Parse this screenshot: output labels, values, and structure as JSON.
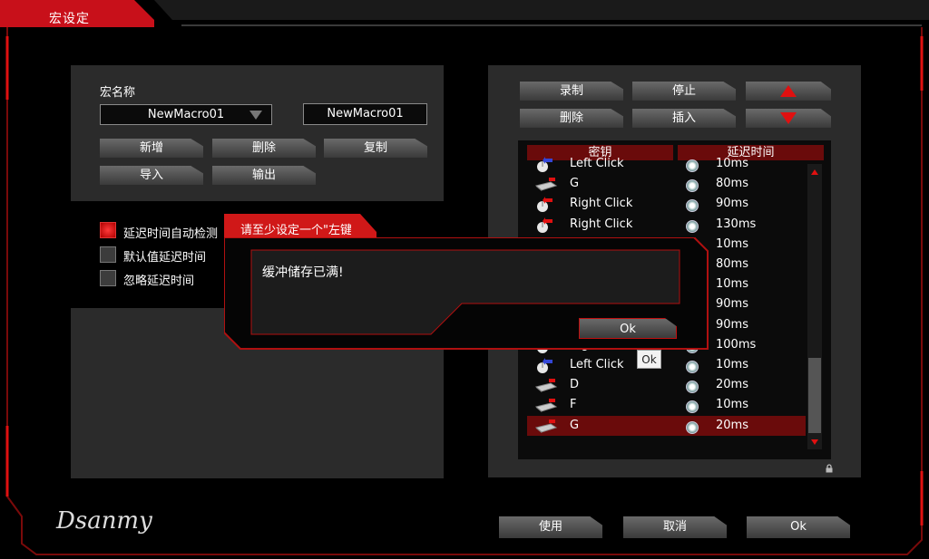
{
  "window": {
    "title": "宏设定"
  },
  "left_panel": {
    "macro_name_label": "宏名称",
    "macro_select_value": "NewMacro01",
    "macro_name_input": "NewMacro01",
    "buttons": {
      "add": "新增",
      "delete": "删除",
      "copy": "复制",
      "import": "导入",
      "export": "输出"
    }
  },
  "options": {
    "auto_detect": "延迟时间自动检测",
    "default_delay": "默认值延迟时间",
    "ignore_delay": "忽略延迟时间",
    "auto_detect_checked": true,
    "default_delay_checked": false,
    "ignore_delay_checked": false
  },
  "right_panel": {
    "buttons": {
      "record": "录制",
      "stop": "停止",
      "delete": "删除",
      "insert": "插入"
    },
    "columns": {
      "key": "密钥",
      "delay": "延迟时间"
    },
    "rows": [
      {
        "icon": "mouse-left-icon",
        "key": "Left Click",
        "delay": "10ms"
      },
      {
        "icon": "keyboard-icon",
        "key": "G",
        "delay": "80ms"
      },
      {
        "icon": "mouse-right-icon",
        "key": "Right Click",
        "delay": "90ms"
      },
      {
        "icon": "mouse-right-icon",
        "key": "Right Click",
        "delay": "130ms"
      },
      {
        "icon": "",
        "key": "",
        "delay": "10ms"
      },
      {
        "icon": "",
        "key": "",
        "delay": "80ms"
      },
      {
        "icon": "",
        "key": "",
        "delay": "10ms"
      },
      {
        "icon": "",
        "key": "",
        "delay": "90ms"
      },
      {
        "icon": "",
        "key": "",
        "delay": "90ms"
      },
      {
        "icon": "mouse-right-icon",
        "key": "Right Click",
        "delay": "100ms"
      },
      {
        "icon": "mouse-left-icon",
        "key": "Left Click",
        "delay": "10ms"
      },
      {
        "icon": "keyboard-icon",
        "key": "D",
        "delay": "20ms"
      },
      {
        "icon": "keyboard-icon",
        "key": "F",
        "delay": "10ms"
      },
      {
        "icon": "keyboard-icon",
        "key": "G",
        "delay": "20ms",
        "selected": true
      }
    ]
  },
  "footer": {
    "logo": "Dsanmy",
    "apply": "使用",
    "cancel": "取消",
    "ok": "Ok"
  },
  "dialog": {
    "behind_title": "请至少设定一个\"左键",
    "message": "缓冲储存已满!",
    "ok": "Ok",
    "tooltip": "Ok"
  },
  "colors": {
    "accent": "#e01010",
    "header_red": "#6a0b0b",
    "panel": "#2b2b2b",
    "background": "#000000"
  }
}
